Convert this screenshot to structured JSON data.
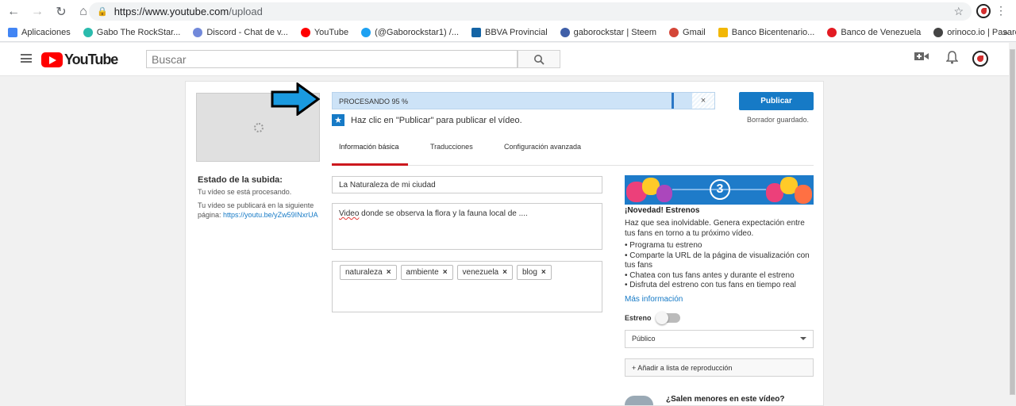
{
  "browser": {
    "url_host": "https://www.youtube.com",
    "url_path": "/upload",
    "bookmarks": [
      {
        "label": "Aplicaciones",
        "color": "#4285f4"
      },
      {
        "label": "Gabo The RockStar...",
        "color": "#2bbbad"
      },
      {
        "label": "Discord - Chat de v...",
        "color": "#7289da"
      },
      {
        "label": "YouTube",
        "color": "#ff0000"
      },
      {
        "label": "(@Gaborockstar1) /...",
        "color": "#1da1f2"
      },
      {
        "label": "BBVA Provincial",
        "color": "#1464a5"
      },
      {
        "label": "gaborockstar | Steem",
        "color": "#3f5fa8"
      },
      {
        "label": "Gmail",
        "color": "#d44638"
      },
      {
        "label": "Banco Bicentenario...",
        "color": "#f2b705"
      },
      {
        "label": "Banco de Venezuela",
        "color": "#e31b23"
      },
      {
        "label": "orinoco.io | Pasarel...",
        "color": "#444444"
      }
    ]
  },
  "header": {
    "logo_text": "YouTube",
    "search_placeholder": "Buscar"
  },
  "upload": {
    "progress_label": "PROCESANDO 95 %",
    "progress_value": 0.95,
    "close_label": "×",
    "publish_label": "Publicar",
    "saved_text": "Borrador guardado.",
    "hint_star": "★",
    "hint_text": "Haz clic en \"Publicar\" para publicar el vídeo.",
    "status_title": "Estado de la subida:",
    "status_processing": "Tu vídeo se está procesando.",
    "status_link_prefix": "Tu vídeo se publicará en la siguiente página:",
    "status_link": "https://youtu.be/yZw59INxrUA"
  },
  "tabs": [
    {
      "label": "Información básica",
      "active": true
    },
    {
      "label": "Traducciones",
      "active": false
    },
    {
      "label": "Configuración avanzada",
      "active": false
    }
  ],
  "form": {
    "title_value": "La Naturaleza de mi ciudad",
    "desc_word": "Video",
    "desc_rest": " donde se observa la flora y la fauna local de ....",
    "tags": [
      "naturaleza",
      "ambiente",
      "venezuela",
      "blog"
    ],
    "tag_remove": "×"
  },
  "side": {
    "banner_number": "3",
    "news_title": "¡Novedad! Estrenos",
    "news_body": "Haz que sea inolvidable. Genera expectación entre tus fans en torno a tu próximo vídeo.",
    "news_items": [
      "Programa tu estreno",
      "Comparte la URL de la página de visualización con tus fans",
      "Chatea con tus fans antes y durante el estreno",
      "Disfruta del estreno con tus fans en tiempo real"
    ],
    "more_link": "Más información",
    "premiere_label": "Estreno",
    "premiere_on": false,
    "privacy_value": "Público",
    "add_playlist": "+ Añadir a lista de reproducción",
    "minors_title": "¿Salen menores en este vídeo?"
  },
  "colors": {
    "accent": "#167ac6",
    "youtube_red": "#ff0000",
    "tab_underline": "#cc181e",
    "annotation_arrow": "#1a9ae0"
  }
}
